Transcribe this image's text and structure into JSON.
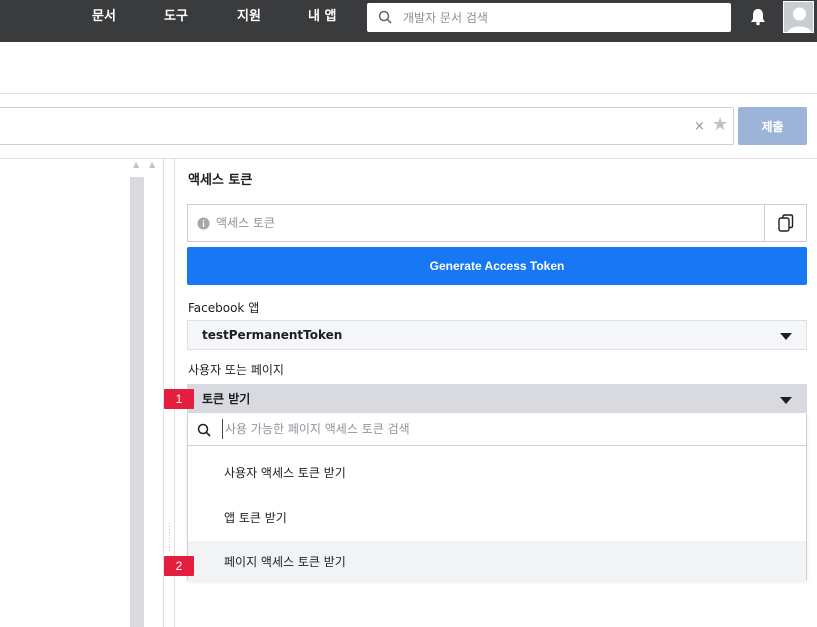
{
  "topbar": {
    "nav": [
      "문서",
      "도구",
      "지원",
      "내 앱"
    ],
    "search_placeholder": "개발자 문서 검색",
    "icons": [
      "search-icon",
      "bell-icon",
      "avatar"
    ]
  },
  "url_bar": {
    "clear_label": "×",
    "star_label": "★",
    "submit_label": "제출"
  },
  "panel": {
    "title": "액세스 토큰",
    "token_placeholder": "액세스 토큰",
    "generate_label": "Generate Access Token",
    "app_label": "Facebook 앱",
    "app_value": "testPermanentToken",
    "user_page_label": "사용자 또는 페이지",
    "user_page_value": "토큰 받기",
    "dropdown": {
      "search_placeholder": "사용 가능한 페이지 액세스 토큰 검색",
      "items": [
        "사용자 액세스 토큰 받기",
        "앱 토큰 받기",
        "페이지 액세스 토큰 받기"
      ]
    }
  },
  "badges": [
    "1",
    "2"
  ],
  "colors": {
    "topbar": "#3a3b3d",
    "primary": "#1877f2",
    "submit_disabled": "#9cb4d8",
    "badge": "#e41e3f"
  }
}
